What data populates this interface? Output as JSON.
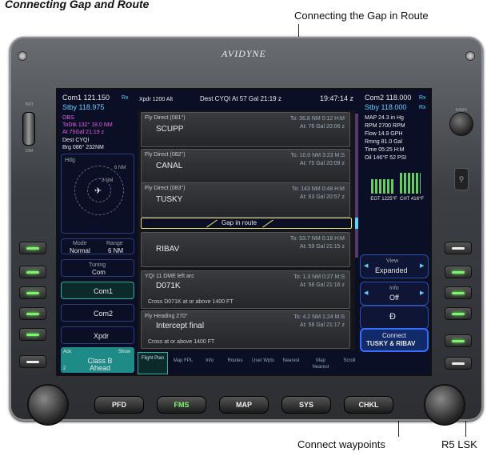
{
  "annotations": {
    "title": "Connecting Gap and Route",
    "gap_label": "Connecting  the Gap in Route",
    "connect_label": "Connect waypoints",
    "lsk_label": "R5 LSK"
  },
  "device": {
    "logo": "AVIDYNE",
    "left_toggle_top": "BRT",
    "left_toggle_bottom": "DIM",
    "right_knob_label": "BARO",
    "bottom_buttons": [
      "PFD",
      "FMS",
      "MAP",
      "SYS",
      "CHKL"
    ]
  },
  "top_bar": {
    "com1": "Com1 121.150",
    "com1_rx": "Rx",
    "com1_stby": "Stby  118.975",
    "xpdr": "Xpdr 1200 Alt",
    "dest": "Dest CYQI At 57 Gal 21:19 z",
    "clock": "19:47:14 z",
    "com2": "Com2 118.000",
    "com2_rx": "Rx",
    "com2_stby": "Stby  118.000",
    "com2_stby_rx": "Rx"
  },
  "left_info": {
    "obs": "OBS",
    "to_dtk": "ToDtk 132° 18.0 NM",
    "at": "At  75Gal 21:19 z",
    "dest": "Dest  CYQI",
    "brg": "Brg  086°  232NM",
    "hdg": "Hdg",
    "range_6": "6 NM",
    "range_2": "2 NM"
  },
  "right_info": {
    "map": "MAP   24.3 in Hg",
    "rpm": "RPM   2700 RPM",
    "flow": "Flow   14.9 GPH",
    "rmng": "Rmng   81.0 Gal",
    "time": "Time   05:25 H:M",
    "oil": "Oil  146°F  52 PSI",
    "egt": "EGT 1225°F",
    "cht": "CHT 416°F"
  },
  "left_buttons": {
    "mode_label": "Mode",
    "mode_value": "Normal",
    "range_label": "Range",
    "range_value": "6 NM",
    "tuning_label": "Tuning",
    "tuning_value": "Com",
    "com1": "Com1",
    "com2": "Com2",
    "xpdr": "Xpdr",
    "ack": "Ack",
    "show": "Show",
    "alert": "Class B Ahead",
    "alert_count": "2"
  },
  "flight_plan": [
    {
      "header": "Fly Direct (081°)",
      "wp": "SCUPP",
      "to": "To: 36.8 NM   0:12 H:M",
      "at": "At: 76 Gal  20:06 z"
    },
    {
      "header": "Fly Direct (082°)",
      "wp": "CANAL",
      "to": "To: 10.0 NM   3:23 M:S",
      "at": "At: 75 Gal  20:09 z"
    },
    {
      "header": "Fly Direct (083°)",
      "wp": "TUSKY",
      "to": "To: 143 NM   0:48 H:M",
      "at": "At: 63 Gal  20:57 z"
    },
    {
      "header": "",
      "wp": "RIBAV",
      "to": "To: 53.7 NM   0:18 H:M",
      "at": "At: 59 Gal  21:15 z"
    },
    {
      "header": "YQI 11 DME left arc",
      "wp": "D071K",
      "to": "To: 1.3 NM   0:27 M:S",
      "at": "At: 58 Gal  21:16 z",
      "note": "Cross D071K at or above 1400 FT"
    },
    {
      "header": "Fly Heading 270°",
      "wp": "Intercept final",
      "to": "To: 4.2 NM   1:24 M:S",
      "at": "At: 58 Gal  21:17 z",
      "note": "Cross  at or above 1400 FT"
    }
  ],
  "gap": {
    "label": "Gap in route"
  },
  "right_buttons": {
    "view_label": "View",
    "view_value": "Expanded",
    "info_label": "Info",
    "info_value": "Off",
    "connect_line1": "Connect",
    "connect_line2": "TUSKY & RIBAV"
  },
  "tabs": [
    "Flight Plan",
    "Map FPL",
    "Info",
    "Routes",
    "User Wpts",
    "Nearest",
    "Map Nearest",
    "Scroll"
  ],
  "colors": {
    "screen_bg": "#0b0f26",
    "cyan": "#5fd0ff",
    "green": "#7cf56a",
    "magenta": "#e05fe0",
    "gap_yellow": "#e8e070"
  }
}
